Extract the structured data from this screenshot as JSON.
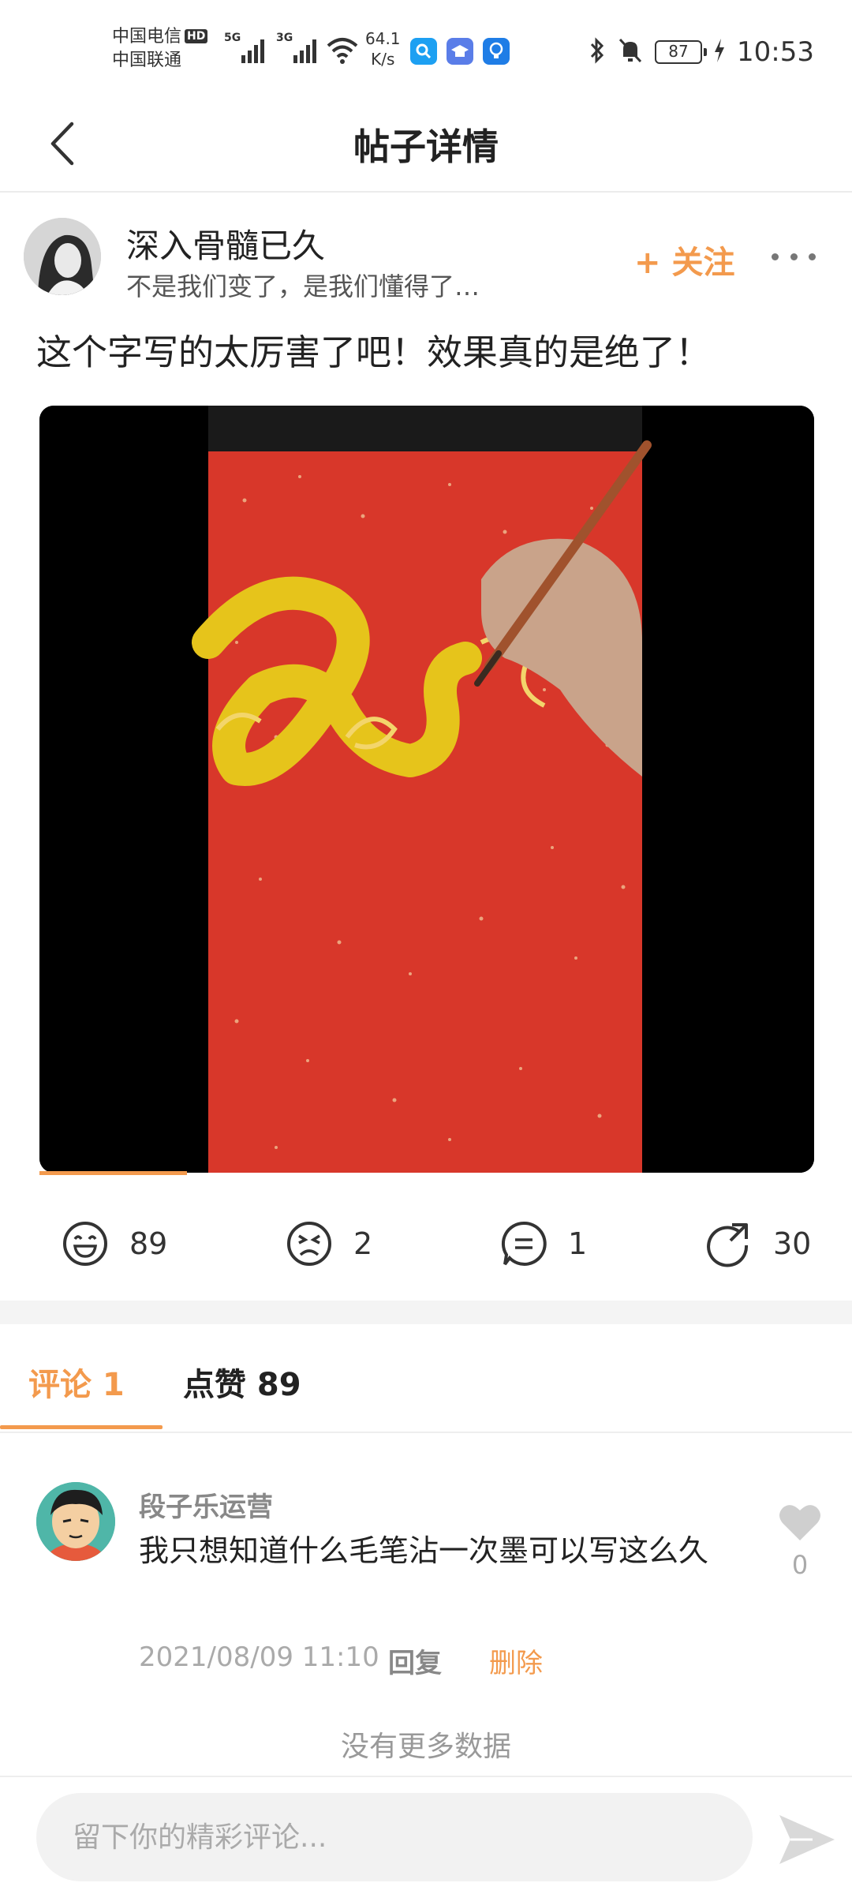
{
  "status_bar": {
    "carrier1": "中国电信",
    "carrier1_badge": "HD",
    "carrier2": "中国联通",
    "signal1_tag": "5G",
    "signal2_tag": "3G",
    "net_speed_value": "64.1",
    "net_speed_unit": "K/s",
    "battery": "87",
    "time": "10:53"
  },
  "header": {
    "title": "帖子详情"
  },
  "post": {
    "author_name": "深入骨髓已久",
    "author_signature": "不是我们变了，是我们懂得了…",
    "follow_label": "+ 关注",
    "text": "这个字写的太厉害了吧！效果真的是绝了！",
    "video_progress": 0.19
  },
  "stats": {
    "laugh_count": "89",
    "dislike_count": "2",
    "comment_count": "1",
    "share_count": "30"
  },
  "tabs": [
    {
      "label": "评论 1",
      "active": true
    },
    {
      "label": "点赞 89",
      "active": false
    }
  ],
  "comments": [
    {
      "user": "段子乐运营",
      "text": "我只想知道什么毛笔沾一次墨可以写这么久",
      "likes": "0",
      "time": "2021/08/09 11:10",
      "reply_label": "回复",
      "delete_label": "删除"
    }
  ],
  "no_more_text": "没有更多数据",
  "comment_input": {
    "placeholder": "留下你的精彩评论..."
  },
  "colors": {
    "accent": "#f39a4d",
    "video_red": "#d93a2a",
    "gold": "#e6c41b"
  }
}
